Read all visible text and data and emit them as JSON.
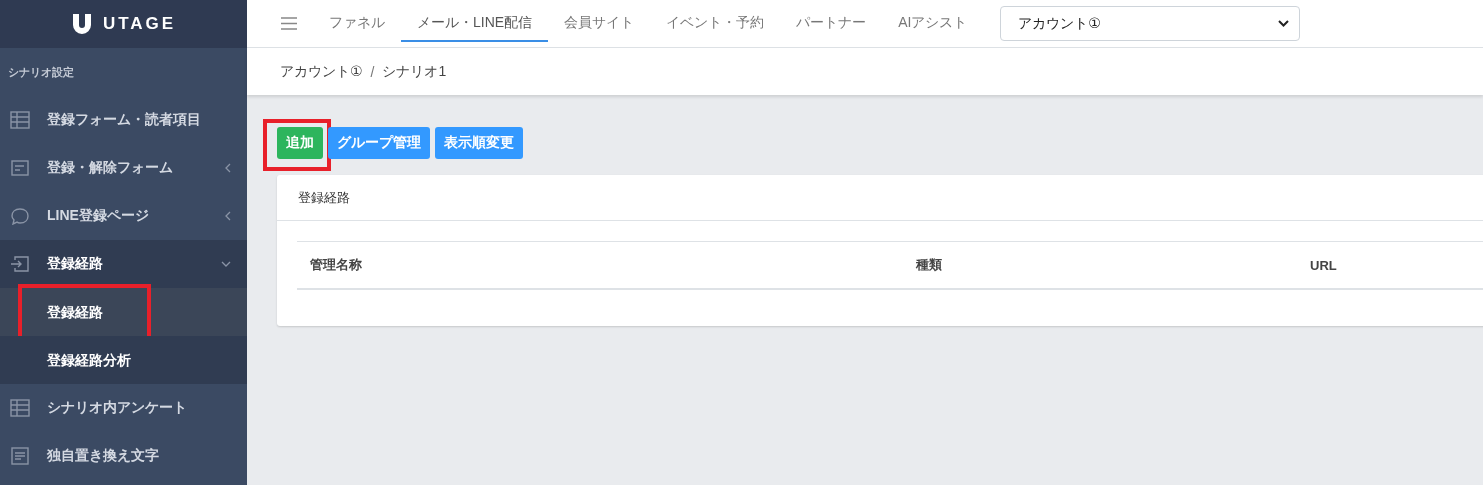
{
  "logo": {
    "text": "UTAGE"
  },
  "sidebar": {
    "section_title": "シナリオ設定",
    "items": [
      {
        "label": "登録フォーム・読者項目",
        "has_submenu": false,
        "expanded": false
      },
      {
        "label": "登録・解除フォーム",
        "has_submenu": true,
        "expanded": false
      },
      {
        "label": "LINE登録ページ",
        "has_submenu": true,
        "expanded": false
      },
      {
        "label": "登録経路",
        "has_submenu": true,
        "expanded": true,
        "children": [
          {
            "label": "登録経路",
            "selected": true,
            "highlighted": true
          },
          {
            "label": "登録経路分析",
            "selected": false,
            "highlighted": false
          }
        ]
      },
      {
        "label": "シナリオ内アンケート",
        "has_submenu": false,
        "expanded": false
      },
      {
        "label": "独自置き換え文字",
        "has_submenu": false,
        "expanded": false
      }
    ]
  },
  "top_nav": {
    "tabs": [
      {
        "label": "ファネル",
        "selected": false
      },
      {
        "label": "メール・LINE配信",
        "selected": true
      },
      {
        "label": "会員サイト",
        "selected": false
      },
      {
        "label": "イベント・予約",
        "selected": false
      },
      {
        "label": "パートナー",
        "selected": false
      },
      {
        "label": "AIアシスト",
        "selected": false
      }
    ],
    "account_select": {
      "value": "アカウント①"
    }
  },
  "breadcrumb": {
    "items": [
      "アカウント①",
      "シナリオ1"
    ],
    "separator": "/"
  },
  "buttons": [
    {
      "label": "追加",
      "kind": "success",
      "highlighted": true
    },
    {
      "label": "グループ管理",
      "kind": "primary",
      "highlighted": false
    },
    {
      "label": "表示順変更",
      "kind": "primary",
      "highlighted": false
    }
  ],
  "card": {
    "title": "登録経路",
    "table": {
      "columns": [
        "管理名称",
        "種類",
        "URL"
      ]
    }
  }
}
